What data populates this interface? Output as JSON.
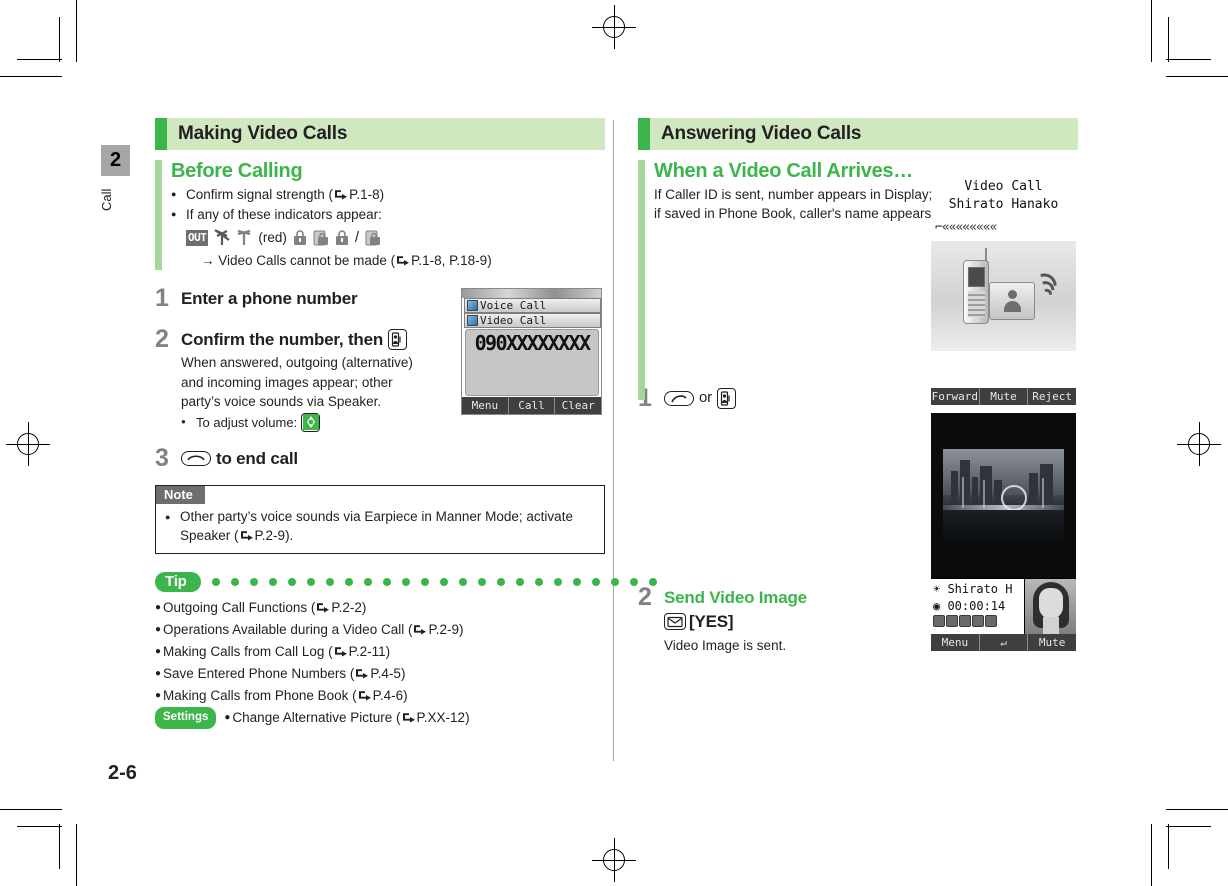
{
  "page": {
    "folio": "2-6",
    "chapter_number": "2",
    "chapter_label": "Call",
    "accent_green": "#3cb54a",
    "header_bg": "#cfe8bf",
    "sub_bar": "#a6d79a",
    "step_num_color": "#808285"
  },
  "left_column": {
    "section_title": "Making Video Calls",
    "subsection": {
      "title": "Before Calling",
      "bullets": [
        "Confirm signal strength (☞PP.1-8)",
        "If any of these indicators appear:"
      ],
      "bullet1_text": "Confirm signal strength (",
      "bullet1_ref": "P.1-8",
      "bullet2_text": "If any of these indicators appear:",
      "indicators": [
        "OUT",
        "antenna-crossed-icon",
        "antenna-icon",
        "(red)",
        "lock-icon",
        "lock-card-icon",
        "lock-slash-card-icon"
      ],
      "indicators_red_label": "(red)",
      "result_text": "Video Calls cannot be made (",
      "result_ref": "P.1-8, P.18-9",
      "result_arrow": "→"
    },
    "steps": [
      {
        "num": "1",
        "head": "Enter a phone number"
      },
      {
        "num": "2",
        "head": "Confirm the number, then",
        "head_key": "video-call-key",
        "desc": "When answered, outgoing (alternative) and incoming images appear; other party’s voice sounds via Speaker.",
        "subnote": "To adjust volume:",
        "subnote_key": "volume-multi-key"
      },
      {
        "num": "3",
        "head_key": "end-call-key",
        "head": "to end call"
      }
    ],
    "note": {
      "label": "Note",
      "text_a": "Other party’s voice sounds via Earpiece in Manner Mode; activate Speaker (",
      "ref": "P.2-9",
      "text_b": ")."
    },
    "tip": {
      "label": "Tip",
      "dot_count": 24,
      "items": [
        {
          "text": "Outgoing Call Functions (",
          "ref": "P.2-2",
          "badge": null
        },
        {
          "text": "Operations Available during a Video Call (",
          "ref": "P.2-9",
          "badge": null
        },
        {
          "text": "Making Calls from Call Log (",
          "ref": "P.2-11",
          "badge": null
        },
        {
          "text": "Save Entered Phone Numbers (",
          "ref": "P.4-5",
          "badge": null
        },
        {
          "text": "Making Calls from Phone Book (",
          "ref": "P.4-6",
          "badge": null
        },
        {
          "text": "Change Alternative Picture (",
          "ref": "P.XX-12",
          "badge": "Settings"
        }
      ]
    }
  },
  "right_column": {
    "section_title": "Answering Video Calls",
    "subsection": {
      "title": "When a Video Call Arrives…",
      "line1": "If Caller ID is sent, number appears in Display;",
      "line2": "if saved in Phone Book, caller's name appears."
    },
    "steps": [
      {
        "num": "1",
        "key_a": "send-call-key",
        "or_text": "or",
        "key_b": "video-call-key"
      },
      {
        "num": "2",
        "head": "Send Video Image",
        "key": "mail-key",
        "key_label": "[YES]",
        "desc": "Video Image is sent."
      }
    ]
  },
  "screenshots": {
    "dial": {
      "name": "dial-screen",
      "menu_items": [
        "Voice Call",
        "Video Call"
      ],
      "number": "090XXXXXXXX",
      "softkeys": [
        "Menu",
        "Call",
        "Clear"
      ]
    },
    "incoming": {
      "name": "incoming-video-call-screen",
      "line1": "Video Call",
      "line2": "Shirato Hanako",
      "ring_glyph": "⌐««««««««",
      "softkeys": [
        "Forward",
        "Mute",
        "Reject"
      ]
    },
    "incall": {
      "name": "video-call-in-progress-screen",
      "caller": "Shirato H",
      "timer": "00:00:14",
      "softkeys": [
        "Menu",
        "↵",
        "Mute"
      ]
    }
  }
}
